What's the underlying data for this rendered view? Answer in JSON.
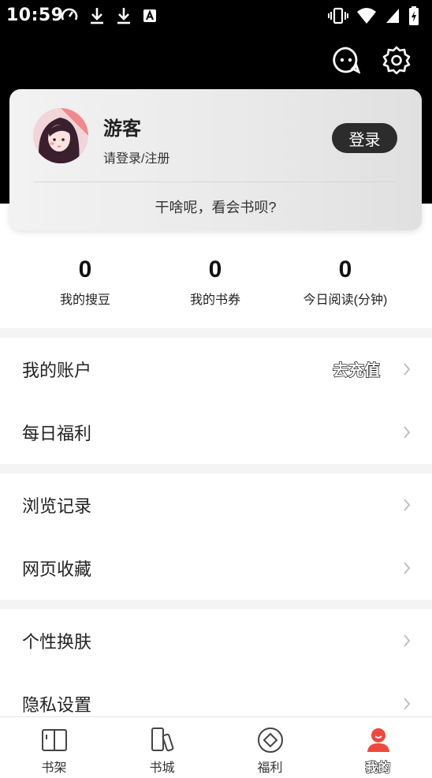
{
  "status_bar": {
    "time": "10:59"
  },
  "profile_card": {
    "user_name": "游客",
    "login_hint": "请登录/注册",
    "login_button": "登录",
    "slogan": "干啥呢，看会书呗?"
  },
  "stats": [
    {
      "value": "0",
      "label": "我的搜豆"
    },
    {
      "value": "0",
      "label": "我的书券"
    },
    {
      "value": "0",
      "label": "今日阅读(分钟)"
    }
  ],
  "menu": {
    "account": {
      "label": "我的账户",
      "action": "去充值"
    },
    "daily_welfare": {
      "label": "每日福利"
    },
    "history": {
      "label": "浏览记录"
    },
    "bookmarks": {
      "label": "网页收藏"
    },
    "skin": {
      "label": "个性换肤"
    },
    "privacy": {
      "label": "隐私设置"
    }
  },
  "bottom_nav": [
    {
      "label": "书架",
      "icon": "book-open-icon"
    },
    {
      "label": "书城",
      "icon": "books-icon"
    },
    {
      "label": "福利",
      "icon": "diamond-circle-icon"
    },
    {
      "label": "我的",
      "icon": "user-icon"
    }
  ],
  "colors": {
    "accent": "#f0483a",
    "header_bg": "#000000",
    "login_button_bg": "#2c2c2c"
  }
}
